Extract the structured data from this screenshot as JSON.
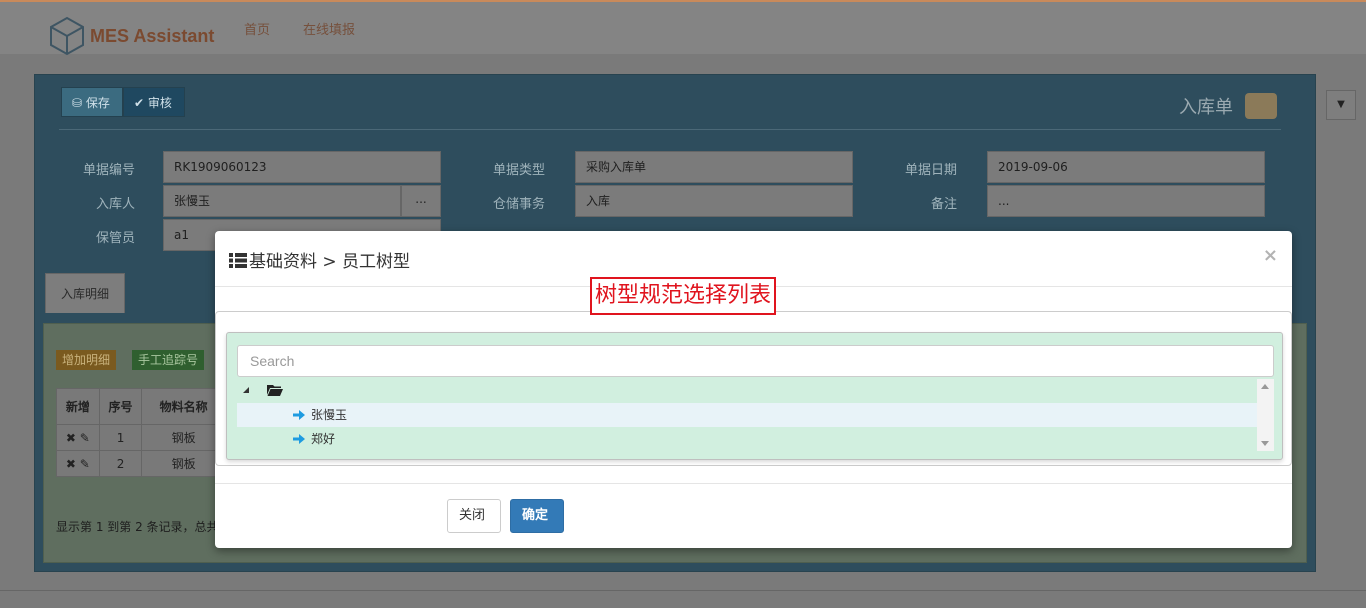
{
  "app": {
    "brand": "MES Assistant"
  },
  "nav": {
    "home": "首页",
    "online_fill": "在线填报"
  },
  "toolbar": {
    "save": "保存",
    "audit": "审核"
  },
  "document": {
    "title": "入库单",
    "fields": {
      "doc_no_label": "单据编号",
      "doc_no": "RK1909060123",
      "doc_type_label": "单据类型",
      "doc_type": "采购入库单",
      "doc_date_label": "单据日期",
      "doc_date": "2019-09-06",
      "receiver_label": "入库人",
      "receiver": "张慢玉",
      "storage_label": "仓储事务",
      "storage": "入库",
      "remark_label": "备注",
      "remark": "...",
      "keeper_label": "保管员",
      "keeper": "a1",
      "ellipsis": "..."
    },
    "tab": "入库明细",
    "grid": {
      "add_detail": "增加明细",
      "manual_track": "手工追踪号",
      "columns": [
        "新增",
        "序号",
        "物料名称"
      ],
      "rows": [
        {
          "seq": "1",
          "material": "钢板"
        },
        {
          "seq": "2",
          "material": "钢板"
        }
      ],
      "footer": "显示第 1 到第 2 条记录，总共"
    }
  },
  "modal": {
    "title": "基础资料 > 员工树型",
    "annotation": "树型规范选择列表",
    "search_placeholder": "Search",
    "tree": {
      "children": [
        "张慢玉",
        "郑好"
      ]
    },
    "buttons": {
      "close": "关闭",
      "ok": "确定"
    }
  },
  "colors": {
    "primary": "#337ab7",
    "tree_bg": "#d1efdf",
    "annotation": "#e0141e",
    "brand": "#e27b42"
  }
}
